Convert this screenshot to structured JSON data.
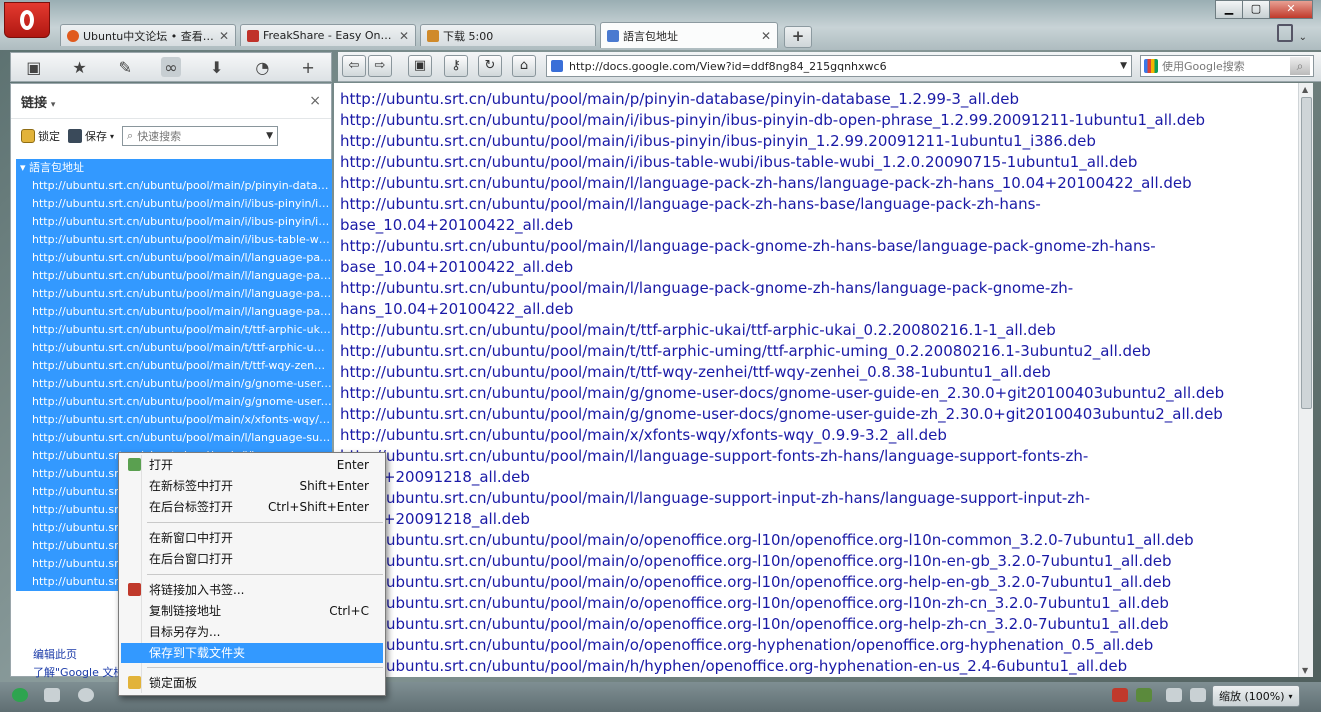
{
  "tabs": [
    {
      "title": "Ubuntu中文论坛 • 查看......",
      "favicon_color": "#e05a1c",
      "active": false
    },
    {
      "title": "FreakShare - Easy One-...",
      "favicon_color": "#c0322a",
      "active": false
    },
    {
      "title": "下载 5:00",
      "favicon_color": "#d08a2a",
      "active": false
    },
    {
      "title": "語言包地址",
      "favicon_color": "#4a7ad0",
      "active": true
    }
  ],
  "new_tab_label": "+",
  "window_controls": {
    "minimize": "▁",
    "maximize": "▢",
    "close": "✕"
  },
  "panel": {
    "title": "链接",
    "close": "×",
    "lock_label": "锁定",
    "save_label": "保存",
    "search_placeholder": "快速搜索",
    "folder": "語言包地址",
    "items": [
      "http://ubuntu.srt.cn/ubuntu/pool/main/p/pinyin-database/pinyin-database_1.2.99-3_all.deb",
      "http://ubuntu.srt.cn/ubuntu/pool/main/i/ibus-pinyin/ibus-pinyin-db-open-phrase",
      "http://ubuntu.srt.cn/ubuntu/pool/main/i/ibus-pinyin/ibus-pinyin_1.2.99",
      "http://ubuntu.srt.cn/ubuntu/pool/main/i/ibus-table-wubi/ibus-table-wubi",
      "http://ubuntu.srt.cn/ubuntu/pool/main/l/language-pack-zh-hans",
      "http://ubuntu.srt.cn/ubuntu/pool/main/l/language-pack-zh-hans-base",
      "http://ubuntu.srt.cn/ubuntu/pool/main/l/language-pack-gnome-zh-hans-base",
      "http://ubuntu.srt.cn/ubuntu/pool/main/l/language-pack-gnome-zh-hans",
      "http://ubuntu.srt.cn/ubuntu/pool/main/t/ttf-arphic-ukai/ttf-arphic-ukai",
      "http://ubuntu.srt.cn/ubuntu/pool/main/t/ttf-arphic-uming/ttf-arphic-uming",
      "http://ubuntu.srt.cn/ubuntu/pool/main/t/ttf-wqy-zenhei/ttf-wqy-zenhei",
      "http://ubuntu.srt.cn/ubuntu/pool/main/g/gnome-user-docs/gnome-user-guide-en",
      "http://ubuntu.srt.cn/ubuntu/pool/main/g/gnome-user-docs/gnome-user-guide-zh",
      "http://ubuntu.srt.cn/ubuntu/pool/main/x/xfonts-wqy/xfonts-wqy",
      "http://ubuntu.srt.cn/ubuntu/pool/main/l/language-support-fonts-zh-hans",
      "http://ubuntu.srt.cn/ubuntu/pool/main/l/language-support-input-zh-hans",
      "http://ubuntu.srt.cn/ubuntu/pool/main/o/openoffice.org-l10n",
      "http://ubuntu.srt.cn/ubuntu/pool/main/o/openoffice.org-l10n",
      "http://ubuntu.srt.cn/ubuntu/pool/main/o/openoffice.org-l10n",
      "http://ubuntu.srt.cn/ubuntu/pool/main/o/openoffice.org-l10n",
      "http://ubuntu.srt.cn/ubuntu/pool/main/o/openoffice.org-l10n",
      "http://ubuntu.srt.cn/ubuntu/pool/main/o/openoffice.org-hyphenation",
      "http://ubuntu.srt.cn/ubuntu/pool/main/h/hyphen/openoffice.org-hyphenation"
    ],
    "footer_edit": "编辑此页",
    "footer_about": "了解\"Google 文档\""
  },
  "address": {
    "url": "http://docs.google.com/View?id=ddf8ng84_215gqnhxwc6"
  },
  "search": {
    "placeholder": "使用Google搜索"
  },
  "content_lines": [
    "http://ubuntu.srt.cn/ubuntu/pool/main/p/pinyin-database/pinyin-database_1.2.99-3_all.deb",
    "http://ubuntu.srt.cn/ubuntu/pool/main/i/ibus-pinyin/ibus-pinyin-db-open-phrase_1.2.99.20091211-1ubuntu1_all.deb",
    "http://ubuntu.srt.cn/ubuntu/pool/main/i/ibus-pinyin/ibus-pinyin_1.2.99.20091211-1ubuntu1_i386.deb",
    "http://ubuntu.srt.cn/ubuntu/pool/main/i/ibus-table-wubi/ibus-table-wubi_1.2.0.20090715-1ubuntu1_all.deb",
    "http://ubuntu.srt.cn/ubuntu/pool/main/l/language-pack-zh-hans/language-pack-zh-hans_10.04+20100422_all.deb",
    "http://ubuntu.srt.cn/ubuntu/pool/main/l/language-pack-zh-hans-base/language-pack-zh-hans-",
    "base_10.04+20100422_all.deb",
    "http://ubuntu.srt.cn/ubuntu/pool/main/l/language-pack-gnome-zh-hans-base/language-pack-gnome-zh-hans-",
    "base_10.04+20100422_all.deb",
    "http://ubuntu.srt.cn/ubuntu/pool/main/l/language-pack-gnome-zh-hans/language-pack-gnome-zh-",
    "hans_10.04+20100422_all.deb",
    "http://ubuntu.srt.cn/ubuntu/pool/main/t/ttf-arphic-ukai/ttf-arphic-ukai_0.2.20080216.1-1_all.deb",
    "http://ubuntu.srt.cn/ubuntu/pool/main/t/ttf-arphic-uming/ttf-arphic-uming_0.2.20080216.1-3ubuntu2_all.deb",
    "http://ubuntu.srt.cn/ubuntu/pool/main/t/ttf-wqy-zenhei/ttf-wqy-zenhei_0.8.38-1ubuntu1_all.deb",
    "http://ubuntu.srt.cn/ubuntu/pool/main/g/gnome-user-docs/gnome-user-guide-en_2.30.0+git20100403ubuntu2_all.deb",
    "http://ubuntu.srt.cn/ubuntu/pool/main/g/gnome-user-docs/gnome-user-guide-zh_2.30.0+git20100403ubuntu2_all.deb",
    "http://ubuntu.srt.cn/ubuntu/pool/main/x/xfonts-wqy/xfonts-wqy_0.9.9-3.2_all.deb",
    "http://ubuntu.srt.cn/ubuntu/pool/main/l/language-support-fonts-zh-hans/language-support-fonts-zh-",
    "10.04+20091218_all.deb",
    "http://ubuntu.srt.cn/ubuntu/pool/main/l/language-support-input-zh-hans/language-support-input-zh-",
    "10.04+20091218_all.deb",
    "http://ubuntu.srt.cn/ubuntu/pool/main/o/openoffice.org-l10n/openoffice.org-l10n-common_3.2.0-7ubuntu1_all.deb",
    "http://ubuntu.srt.cn/ubuntu/pool/main/o/openoffice.org-l10n/openoffice.org-l10n-en-gb_3.2.0-7ubuntu1_all.deb",
    "http://ubuntu.srt.cn/ubuntu/pool/main/o/openoffice.org-l10n/openoffice.org-help-en-gb_3.2.0-7ubuntu1_all.deb",
    "http://ubuntu.srt.cn/ubuntu/pool/main/o/openoffice.org-l10n/openoffice.org-l10n-zh-cn_3.2.0-7ubuntu1_all.deb",
    "http://ubuntu.srt.cn/ubuntu/pool/main/o/openoffice.org-l10n/openoffice.org-help-zh-cn_3.2.0-7ubuntu1_all.deb",
    "http://ubuntu.srt.cn/ubuntu/pool/main/o/openoffice.org-hyphenation/openoffice.org-hyphenation_0.5_all.deb",
    "http://ubuntu.srt.cn/ubuntu/pool/main/h/hyphen/openoffice.org-hyphenation-en-us_2.4-6ubuntu1_all.deb"
  ],
  "context_menu": {
    "open": "打开",
    "open_sc": "Enter",
    "open_new_tab": "在新标签中打开",
    "open_new_tab_sc": "Shift+Enter",
    "open_bg_tab": "在后台标签打开",
    "open_bg_tab_sc": "Ctrl+Shift+Enter",
    "open_new_window": "在新窗口中打开",
    "open_bg_window": "在后台窗口打开",
    "add_bookmark": "将链接加入书签...",
    "copy_link": "复制链接地址",
    "copy_link_sc": "Ctrl+C",
    "save_as": "目标另存为...",
    "save_to_downloads": "保存到下载文件夹",
    "lock_panel": "锁定面板"
  },
  "status": {
    "zoom": "缩放 (100%)"
  }
}
